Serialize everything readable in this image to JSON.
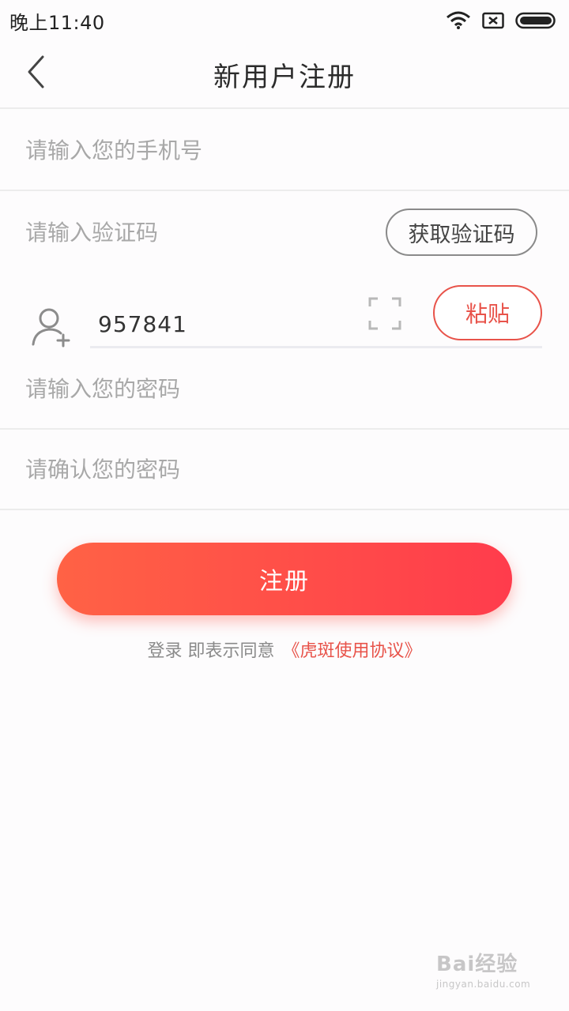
{
  "status_bar": {
    "time": "晚上11:40",
    "icons": [
      "wifi-icon",
      "sim-off-icon",
      "battery-icon"
    ]
  },
  "nav": {
    "back_icon": "chevron-left-icon",
    "title": "新用户注册"
  },
  "form": {
    "phone_placeholder": "请输入您的手机号",
    "code_placeholder": "请输入验证码",
    "get_code_label": "获取验证码",
    "password_placeholder": "请输入您的密码",
    "confirm_placeholder": "请确认您的密码"
  },
  "clipboard_bar": {
    "user_icon": "add-user-icon",
    "text": "957841",
    "scan_icon": "scan-frame-icon",
    "paste_label": "粘贴"
  },
  "register_label": "注册",
  "agreement": {
    "prefix": "登录 即表示同意",
    "link": "《虎斑使用协议》"
  },
  "watermark": {
    "main": "Bai经验",
    "sub": "jingyan.baidu.com"
  },
  "colors": {
    "accent": "#e8534a",
    "button_gradient_start": "#ff6245",
    "button_gradient_end": "#ff3c4c"
  }
}
